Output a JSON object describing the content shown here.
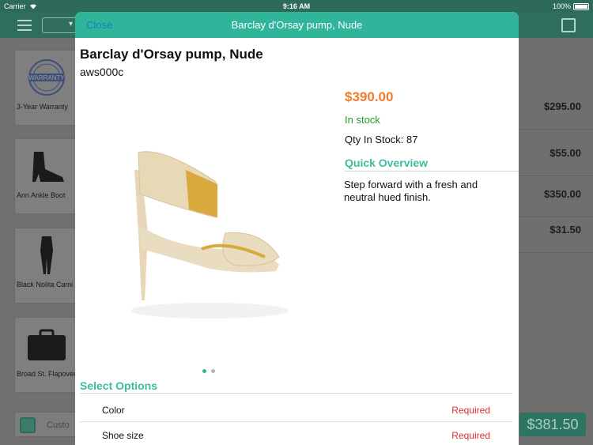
{
  "status_bar": {
    "carrier": "Carrier",
    "time": "9:16 AM",
    "battery": "100%"
  },
  "background": {
    "tiles": [
      {
        "label": "3-Year Warranty",
        "icon": "warranty-seal-icon"
      },
      {
        "label": "Ann Ankle Boot",
        "icon": "ankle-boot-icon"
      },
      {
        "label": "Black Nolita Cami",
        "icon": "cami-icon"
      },
      {
        "label": "Broad St. Flapover Briefcase",
        "icon": "briefcase-icon"
      }
    ],
    "prices": [
      "$295.00",
      "$55.00",
      "$350.00",
      "$31.50"
    ],
    "total": "$381.50",
    "customer_label": "Custo"
  },
  "modal": {
    "close_label": "Close",
    "title": "Barclay d'Orsay pump, Nude",
    "product_name": "Barclay d'Orsay pump, Nude",
    "sku": "aws000c",
    "price": "$390.00",
    "stock_status": "In stock",
    "qty_in_stock": "Qty In Stock: 87",
    "quick_overview_title": "Quick Overview",
    "quick_overview_text": "Step forward with a fresh and neutral hued finish.",
    "image_pages": {
      "count": 2,
      "active": 1
    },
    "select_options_title": "Select Options",
    "options": [
      {
        "name": "Color",
        "status": "Required"
      },
      {
        "name": "Shoe size",
        "status": "Required"
      }
    ]
  },
  "colors": {
    "accent": "#31b59a",
    "price": "#f07c2c",
    "in_stock": "#249a2c",
    "required": "#d8302f",
    "close_link": "#1e7bc4"
  }
}
